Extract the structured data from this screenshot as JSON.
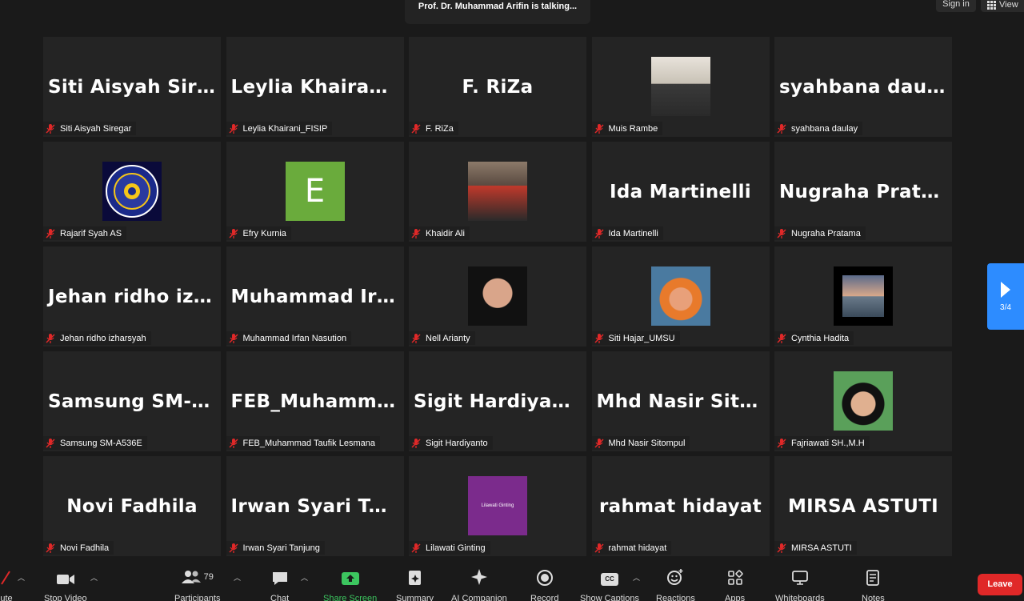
{
  "top": {
    "talking": "Prof. Dr. Muhammad Arifin is talking...",
    "sign_in": "Sign in",
    "view": "View"
  },
  "tiles": [
    {
      "big": "Siti Aisyah Siregar",
      "label": "Siti Aisyah Siregar"
    },
    {
      "big": "Leylia  Khairani_F...",
      "label": "Leylia Khairani_FISIP"
    },
    {
      "big": "F. RiZa",
      "label": "F. RiZa"
    },
    {
      "big": "",
      "label": "Muis Rambe",
      "avatar": "photo"
    },
    {
      "big": "syahbana daulay",
      "label": "syahbana daulay"
    },
    {
      "big": "",
      "label": "Rajarif Syah AS",
      "avatar": "logo"
    },
    {
      "big": "",
      "label": "Efry Kurnia",
      "avatar": "letter",
      "letter": "E"
    },
    {
      "big": "",
      "label": "Khaidir Ali",
      "avatar": "group"
    },
    {
      "big": "Ida Martinelli",
      "label": "Ida Martinelli"
    },
    {
      "big": "Nugraha Pratama",
      "label": "Nugraha Pratama"
    },
    {
      "big": "Jehan ridho izha...",
      "label": "Jehan ridho izharsyah"
    },
    {
      "big": "Muhammad  Irfa...",
      "label": "Muhammad Irfan Nasution"
    },
    {
      "big": "",
      "label": "Nell Arianty",
      "avatar": "hijab1"
    },
    {
      "big": "",
      "label": "Siti Hajar_UMSU",
      "avatar": "hijab2"
    },
    {
      "big": "",
      "label": "Cynthia Hadita",
      "avatar": "sea"
    },
    {
      "big": "Samsung  SM-A5...",
      "label": "Samsung SM-A536E"
    },
    {
      "big": "FEB_Muhammad...",
      "label": "FEB_Muhammad Taufik Lesmana"
    },
    {
      "big": "Sigit Hardiyanto",
      "label": "Sigit Hardiyanto"
    },
    {
      "big": "Mhd Nasir  Sito...",
      "label": "Mhd Nasir Sitompul"
    },
    {
      "big": "",
      "label": "Fajriawati SH.,M.H",
      "avatar": "hijab3"
    },
    {
      "big": "Novi Fadhila",
      "label": "Novi Fadhila"
    },
    {
      "big": "Irwan Syari Tanj...",
      "label": "Irwan Syari Tanjung"
    },
    {
      "big": "",
      "label": "Lilawati Ginting",
      "avatar": "purple",
      "avatar_text": "Lilawati Ginting"
    },
    {
      "big": "rahmat hidayat",
      "label": "rahmat hidayat"
    },
    {
      "big": "MIRSA ASTUTI",
      "label": "MIRSA ASTUTI"
    }
  ],
  "pager": {
    "page": "3/4"
  },
  "toolbar": {
    "mute": "ute",
    "stop_video": "Stop Video",
    "participants": "Participants",
    "participants_count": "79",
    "chat": "Chat",
    "share_screen": "Share Screen",
    "summary": "Summary",
    "ai_companion": "AI Companion",
    "record": "Record",
    "show_captions": "Show Captions",
    "reactions": "Reactions",
    "apps": "Apps",
    "whiteboards": "Whiteboards",
    "notes": "Notes",
    "leave": "Leave",
    "cc": "CC"
  },
  "colors": {
    "share_green": "#3cc65f",
    "leave_red": "#e02828",
    "next_blue": "#2d8cff"
  }
}
